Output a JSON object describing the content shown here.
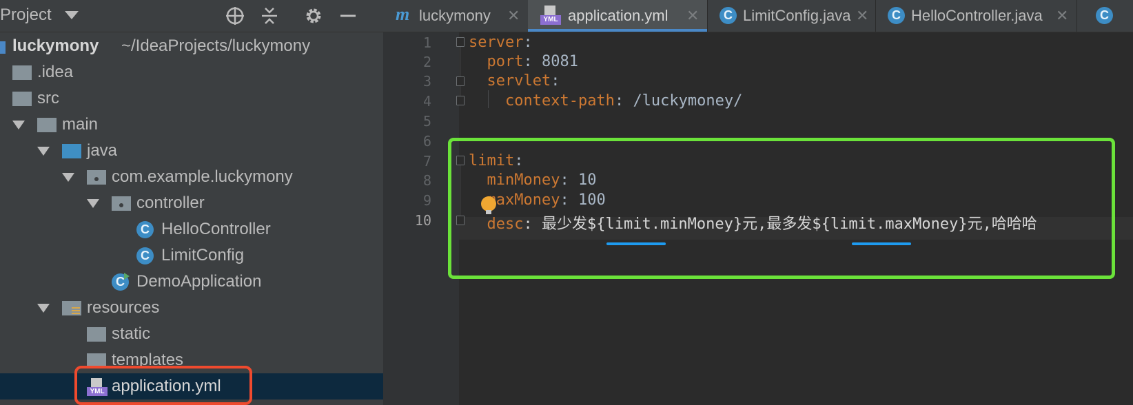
{
  "project_panel": {
    "title": "Project",
    "tree": [
      {
        "label": "luckymony",
        "path": "~/IdeaProjects/luckymony",
        "type": "module",
        "depth": 0
      },
      {
        "label": ".idea",
        "type": "folder",
        "depth": 1
      },
      {
        "label": "src",
        "type": "folder",
        "depth": 1
      },
      {
        "label": "main",
        "type": "folder",
        "depth": 1,
        "expanded": true
      },
      {
        "label": "java",
        "type": "source-folder",
        "depth": 2,
        "expanded": true
      },
      {
        "label": "com.example.luckymony",
        "type": "package",
        "depth": 3,
        "expanded": true
      },
      {
        "label": "controller",
        "type": "package",
        "depth": 4,
        "expanded": true
      },
      {
        "label": "HelloController",
        "type": "class",
        "depth": 5
      },
      {
        "label": "LimitConfig",
        "type": "class",
        "depth": 5
      },
      {
        "label": "DemoApplication",
        "type": "spring-app",
        "depth": 4
      },
      {
        "label": "resources",
        "type": "resources-folder",
        "depth": 2,
        "expanded": true
      },
      {
        "label": "static",
        "type": "folder",
        "depth": 3
      },
      {
        "label": "templates",
        "type": "folder",
        "depth": 3
      },
      {
        "label": "application.yml",
        "type": "yml",
        "depth": 3,
        "selected": true
      }
    ]
  },
  "tabs": [
    {
      "label": "luckymony",
      "icon": "maven-icon",
      "active": false
    },
    {
      "label": "application.yml",
      "icon": "yml-icon",
      "active": true
    },
    {
      "label": "LimitConfig.java",
      "icon": "class-icon",
      "active": false
    },
    {
      "label": "HelloController.java",
      "icon": "class-icon",
      "active": false
    }
  ],
  "editor": {
    "line_numbers": [
      "1",
      "2",
      "3",
      "4",
      "5",
      "6",
      "7",
      "8",
      "9",
      "10"
    ],
    "lines": [
      {
        "indent": "",
        "key": "server",
        "sep": ":",
        "value": "",
        "vclass": "str"
      },
      {
        "indent": "  ",
        "key": "port",
        "sep": ": ",
        "value": "8081",
        "vclass": "num"
      },
      {
        "indent": "  ",
        "key": "servlet",
        "sep": ":",
        "value": "",
        "vclass": "str"
      },
      {
        "indent": "    ",
        "key": "context-path",
        "sep": ": ",
        "value": "/luckymoney/",
        "vclass": "str"
      },
      {
        "indent": "",
        "key": "",
        "sep": "",
        "value": "",
        "vclass": "str"
      },
      {
        "indent": "",
        "key": "",
        "sep": "",
        "value": "",
        "vclass": "str"
      },
      {
        "indent": "",
        "key": "limit",
        "sep": ":",
        "value": "",
        "vclass": "str"
      },
      {
        "indent": "  ",
        "key": "minMoney",
        "sep": ": ",
        "value": "10",
        "vclass": "num"
      },
      {
        "indent": "  ",
        "key": "maxMoney",
        "sep": ": ",
        "value": "100",
        "vclass": "num"
      },
      {
        "indent": "  ",
        "key": "desc",
        "sep": ": ",
        "value": "最少发${limit.minMoney}元,最多发${limit.maxMoney}元,哈哈哈",
        "vclass": "str"
      }
    ]
  },
  "colors": {
    "highlight_box": "#6be23a",
    "selection_box": "#ef4a2e",
    "underline": "#1e9bf0"
  }
}
